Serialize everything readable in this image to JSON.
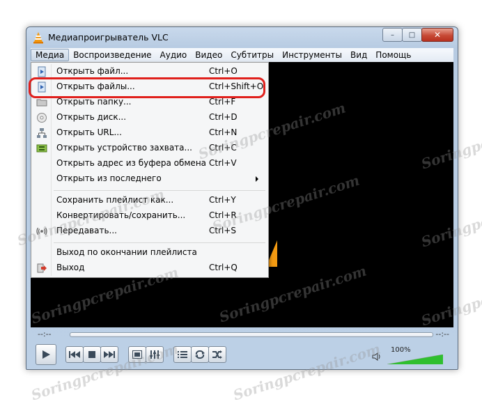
{
  "window": {
    "title": "Медиапроигрыватель VLC",
    "controls": {
      "minimize": "–",
      "maximize": "□",
      "close": "✕"
    }
  },
  "menubar": [
    "Медиа",
    "Воспроизведение",
    "Аудио",
    "Видео",
    "Субтитры",
    "Инструменты",
    "Вид",
    "Помощь"
  ],
  "media_menu": [
    {
      "label": "Открыть файл...",
      "shortcut": "Ctrl+O",
      "icon": "play-file-icon"
    },
    {
      "label": "Открыть файлы...",
      "shortcut": "Ctrl+Shift+O",
      "icon": "play-files-icon",
      "highlighted": true
    },
    {
      "label": "Открыть папку...",
      "shortcut": "Ctrl+F",
      "icon": "folder-icon"
    },
    {
      "label": "Открыть диск...",
      "shortcut": "Ctrl+D",
      "icon": "disc-icon"
    },
    {
      "label": "Открыть URL...",
      "shortcut": "Ctrl+N",
      "icon": "network-icon"
    },
    {
      "label": "Открыть устройство захвата...",
      "shortcut": "Ctrl+C",
      "icon": "capture-device-icon"
    },
    {
      "label": "Открыть адрес из буфера обмена",
      "shortcut": "Ctrl+V",
      "icon": ""
    },
    {
      "label": "Открыть из последнего",
      "shortcut": "",
      "icon": "",
      "submenu": true
    },
    {
      "label": "Сохранить плейлист как...",
      "shortcut": "Ctrl+Y",
      "icon": ""
    },
    {
      "label": "Конвертировать/сохранить...",
      "shortcut": "Ctrl+R",
      "icon": ""
    },
    {
      "label": "Передавать...",
      "shortcut": "Ctrl+S",
      "icon": "stream-icon"
    },
    {
      "label": "Выход по окончании плейлиста",
      "shortcut": "",
      "icon": ""
    },
    {
      "label": "Выход",
      "shortcut": "Ctrl+Q",
      "icon": "exit-icon"
    }
  ],
  "player": {
    "time_elapsed": "--:--",
    "time_total": "--:--",
    "volume_label": "100%",
    "volume": 100
  },
  "watermark": "Soringpcrepair.com",
  "colors": {
    "highlight_ring": "#e0201c",
    "vlc_orange": "#f39a12",
    "volume_green": "#2fbf2f"
  }
}
